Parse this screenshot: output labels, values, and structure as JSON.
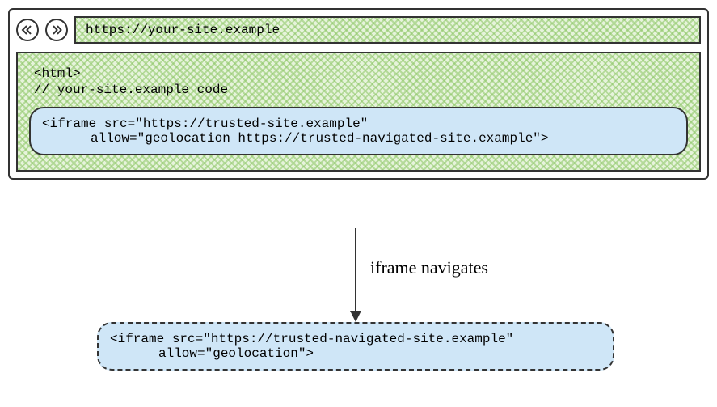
{
  "browser": {
    "url": "https://your-site.example"
  },
  "page_code": {
    "line1": "<html>",
    "line2": "// your-site.example code"
  },
  "iframe_before": {
    "line1": "<iframe src=\"https://trusted-site.example\"",
    "line2": "allow=\"geolocation https://trusted-navigated-site.example\">"
  },
  "arrow_label": "iframe navigates",
  "iframe_after": {
    "line1": "<iframe src=\"https://trusted-navigated-site.example\"",
    "line2": "allow=\"geolocation\">"
  }
}
